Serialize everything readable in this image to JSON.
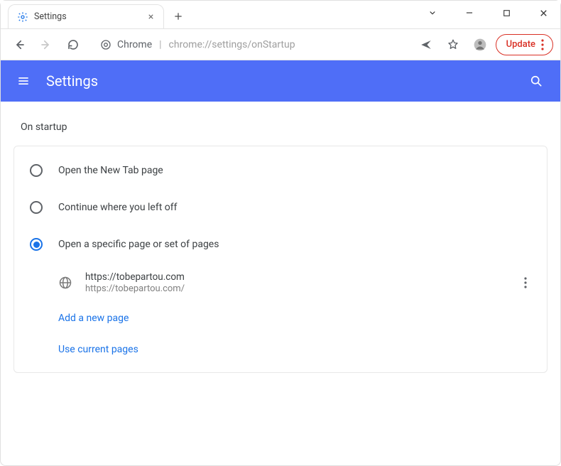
{
  "tab": {
    "title": "Settings"
  },
  "omnibox": {
    "chip": "Chrome",
    "url_prefix": "chrome://",
    "url_path": "settings/onStartup"
  },
  "toolbar": {
    "update_label": "Update"
  },
  "header": {
    "title": "Settings"
  },
  "section": {
    "title": "On startup"
  },
  "options": {
    "new_tab": "Open the New Tab page",
    "continue": "Continue where you left off",
    "specific": "Open a specific page or set of pages"
  },
  "pages": {
    "entry_title": "https://tobepartou.com",
    "entry_url": "https://tobepartou.com/"
  },
  "links": {
    "add_page": "Add a new page",
    "use_current": "Use current pages"
  }
}
